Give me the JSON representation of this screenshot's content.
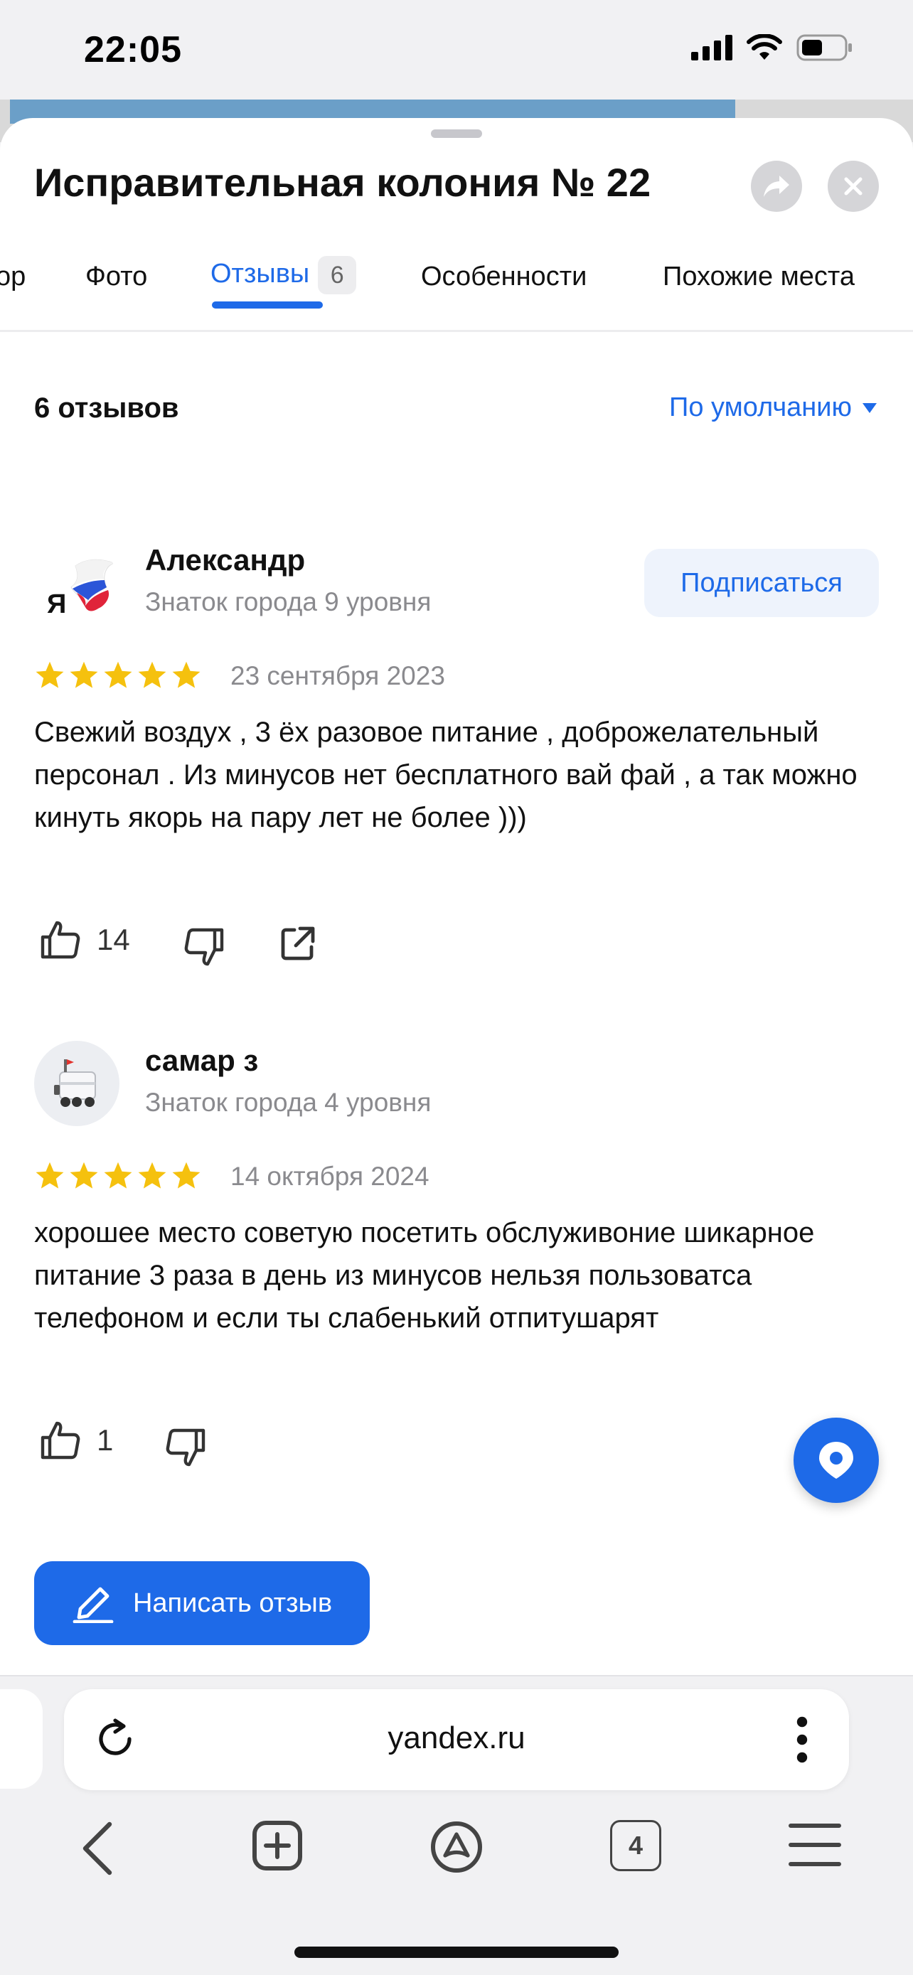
{
  "status_bar": {
    "time": "22:05",
    "icons": [
      "signal-icon",
      "wifi-icon",
      "battery-icon"
    ]
  },
  "header": {
    "title": "Исправительная колония № 22",
    "share_icon": "share-icon",
    "close_icon": "close-icon"
  },
  "tabs": [
    {
      "label": "ор"
    },
    {
      "label": "Фото"
    },
    {
      "label": "Отзывы",
      "badge": "6"
    },
    {
      "label": "Особенности"
    },
    {
      "label": "Похожие места"
    }
  ],
  "reviews_header": {
    "count": "6 отзывов",
    "sort": "По умолчанию"
  },
  "reviews": [
    {
      "author": "Александр",
      "level": "Знаток города 9 уровня",
      "avatar_letter": "Я",
      "subscribe": "Подписаться",
      "rating": 5,
      "date": "23 сентября 2023",
      "text": "Свежий воздух , 3 ёх разовое питание , доброжелательный персонал . Из минусов нет бесплатного вай фай , а так можно кинуть якорь на пару лет не более )))",
      "likes": "14"
    },
    {
      "author": "самар з",
      "level": "Знаток города 4 уровня",
      "rating": 5,
      "date": "14 октября 2024",
      "text": "хорошее место советую посетить обслуживоние шикарное питание 3 раза в день из минусов нельзя пользоватса телефоном и если ты слабенький отпитушарят",
      "likes": "1"
    }
  ],
  "write_review": "Написать отзыв",
  "browser": {
    "url": "yandex.ru",
    "tab_count": "4"
  },
  "colors": {
    "accent": "#1e6ae8",
    "star": "#f5c10e",
    "text_secondary": "#8a8a8e"
  }
}
